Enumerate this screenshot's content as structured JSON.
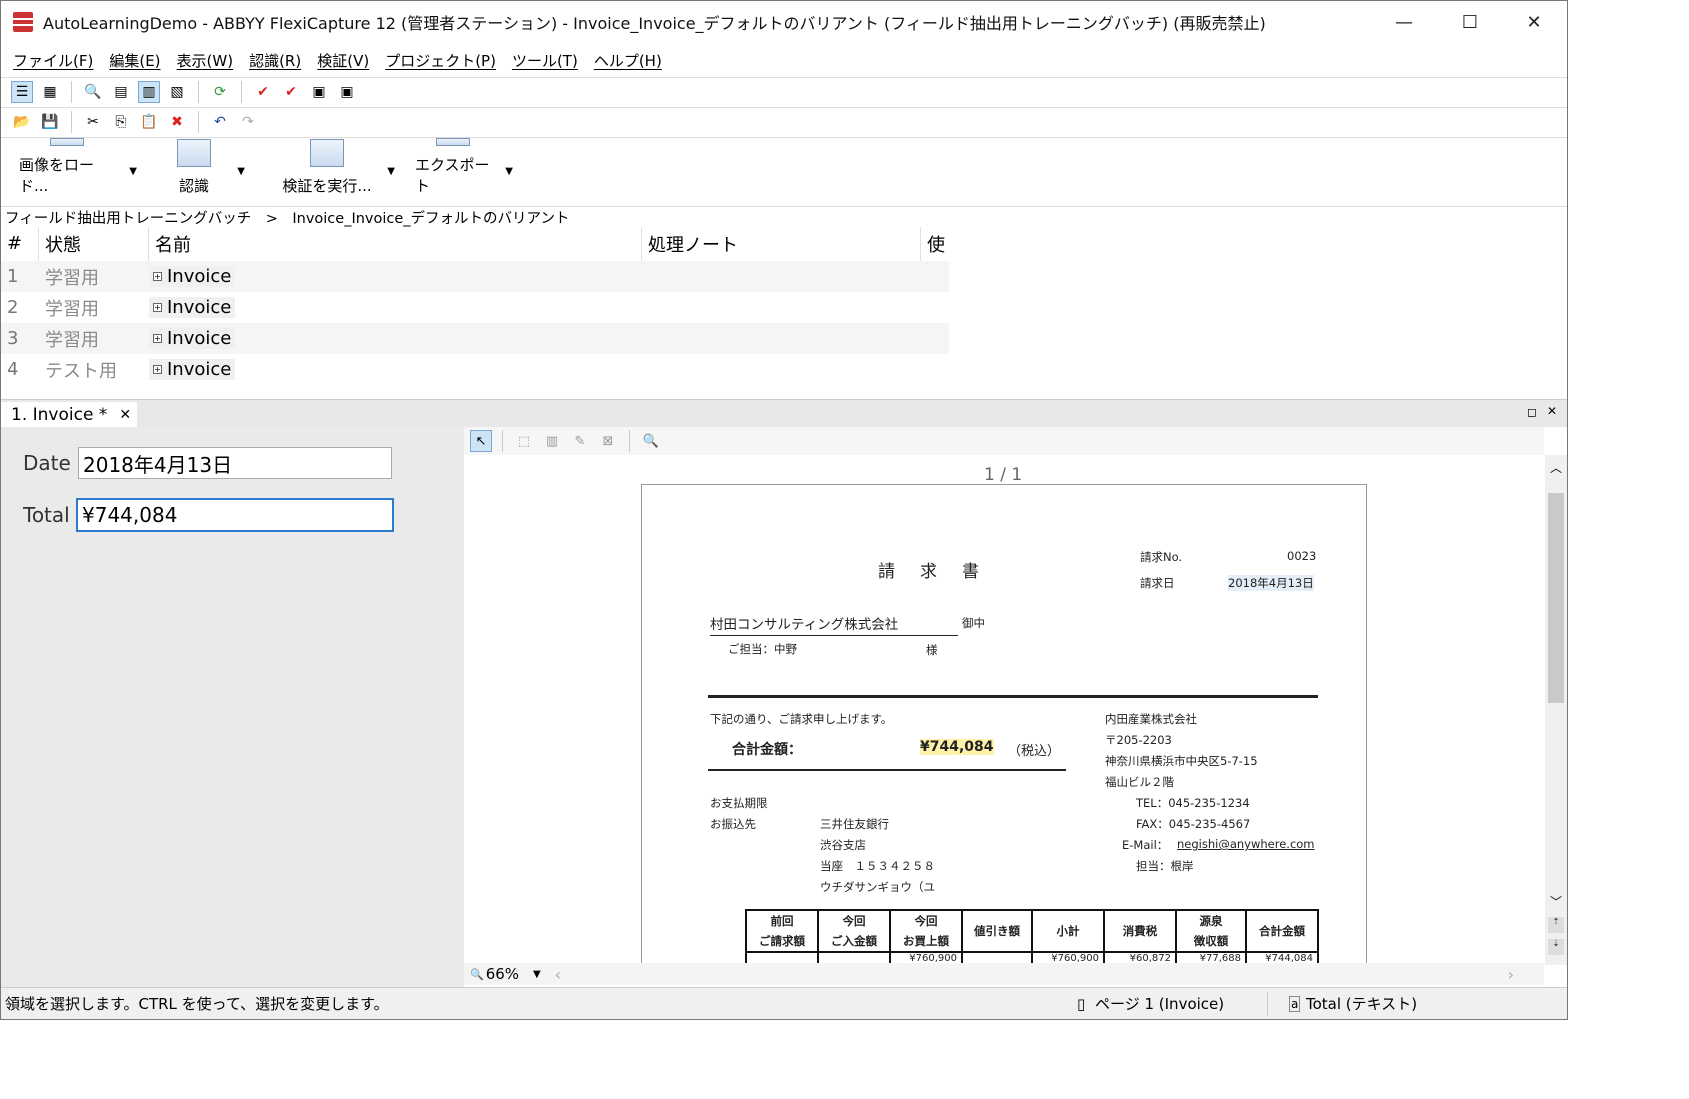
{
  "window": {
    "title": "AutoLearningDemo - ABBYY FlexiCapture 12 (管理者ステーション) - Invoice_Invoice_デフォルトのバリアント (フィールド抽出用トレーニングバッチ) (再販売禁止)",
    "minimize": "—",
    "maximize": "☐",
    "close": "✕"
  },
  "menu": [
    "ファイル(F)",
    "編集(E)",
    "表示(W)",
    "認識(R)",
    "検証(V)",
    "プロジェクト(P)",
    "ツール(T)",
    "ヘルプ(H)"
  ],
  "big_toolbar": {
    "load_images": "画像をロード...",
    "recognize": "認識",
    "run_verification": "検証を実行...",
    "export": "エクスポート"
  },
  "breadcrumb": "フィールド抽出用トレーニングバッチ　>　Invoice_Invoice_デフォルトのバリアント",
  "grid": {
    "headers": {
      "num": "#",
      "status": "状態",
      "name": "名前",
      "note": "処理ノート",
      "extra": "使"
    },
    "rows": [
      {
        "num": "1",
        "status": "学習用",
        "name": "Invoice"
      },
      {
        "num": "2",
        "status": "学習用",
        "name": "Invoice"
      },
      {
        "num": "3",
        "status": "学習用",
        "name": "Invoice"
      },
      {
        "num": "4",
        "status": "テスト用",
        "name": "Invoice"
      }
    ]
  },
  "doc_tab": {
    "label": "1. Invoice *",
    "close": "✕"
  },
  "fields": {
    "date_label": "Date",
    "date_value": "2018年4月13日",
    "total_label": "Total",
    "total_value": "¥744,084"
  },
  "viewer": {
    "page_indicator": "1 / 1",
    "zoom": "66%"
  },
  "invoice": {
    "title": "請　求　書",
    "no_label": "請求No.",
    "no_value": "0023",
    "date_label": "請求日",
    "date_value": "2018年4月13日",
    "customer": "村田コンサルティング株式会社",
    "onchu": "御中",
    "attn": "ご担当：中野",
    "sama": "様",
    "intro": "下記の通り、ご請求申し上げます。",
    "total_label": "合計金額：",
    "total_value": "¥744,084",
    "tax_note": "（税込）",
    "pay_due": "お支払期限",
    "transfer_to": "お振込先",
    "bank": "三井住友銀行",
    "branch": "渋谷支店",
    "account": "当座　１５３４２５８",
    "account_name": "ウチダサンギョウ（ユ",
    "company": "内田産業株式会社",
    "zip": "〒205-2203",
    "address1": "神奈川県横浜市中央区5-7-15",
    "address2": "福山ビル２階",
    "tel": "TEL：045-235-1234",
    "fax": "FAX：045-235-4567",
    "email_label": "E-Mail：",
    "email": "negishi@anywhere.com",
    "contact": "担当：根岸",
    "table_headers": [
      "前回\nご請求額",
      "今回\nご入金額",
      "今回\nお買上額",
      "値引き額",
      "小計",
      "消費税",
      "源泉\n徴収額",
      "合計金額"
    ],
    "table_partial": [
      "",
      "",
      "¥760,900",
      "",
      "¥760,900",
      "¥60,872",
      "¥77,688",
      "¥744,084"
    ]
  },
  "status": {
    "message": "領域を選択します。CTRL を使って、選択を変更します。",
    "page": "ページ 1 (Invoice)",
    "field": "Total (テキスト)"
  },
  "colors": {
    "accent": "#2c7bd0",
    "highlight": "#fff2a8"
  }
}
